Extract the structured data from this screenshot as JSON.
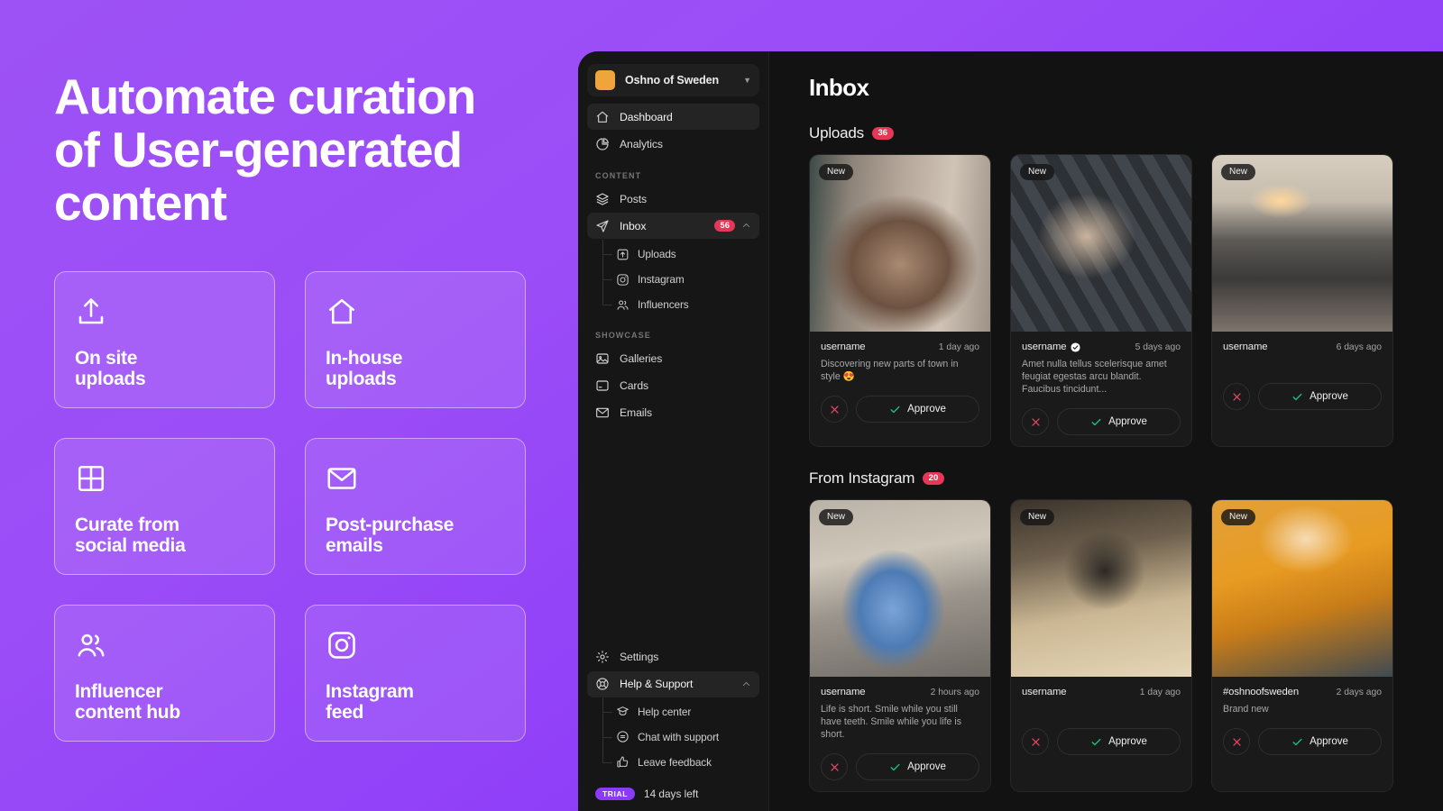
{
  "marketing": {
    "headline": "Automate curation\nof User-generated\ncontent",
    "features": [
      {
        "icon": "upload-icon",
        "label": "On site\nuploads"
      },
      {
        "icon": "home-icon",
        "label": "In-house\nuploads"
      },
      {
        "icon": "grid-icon",
        "label": "Curate from\nsocial media"
      },
      {
        "icon": "envelope-icon",
        "label": "Post-purchase\nemails"
      },
      {
        "icon": "users-icon",
        "label": "Influencer\ncontent hub"
      },
      {
        "icon": "instagram-icon",
        "label": "Instagram\nfeed"
      }
    ]
  },
  "colors": {
    "brand_purple": "#8b3bf8",
    "workspace_logo": "#f0a43c",
    "badge_red": "#e63756",
    "approve_green": "#19c37d",
    "reject_red": "#e8476a"
  },
  "sidebar": {
    "workspace": {
      "name": "Oshno of Sweden",
      "caret": "chevron-down-icon"
    },
    "top_items": [
      {
        "label": "Dashboard",
        "icon": "home-icon",
        "active": true
      },
      {
        "label": "Analytics",
        "icon": "pie-chart-icon",
        "active": false
      }
    ],
    "content_section": {
      "title": "CONTENT"
    },
    "content_items": [
      {
        "label": "Posts",
        "icon": "layers-icon",
        "active": false
      },
      {
        "label": "Inbox",
        "icon": "send-icon",
        "active": true,
        "badge": "56",
        "chevron": "chevron-up-icon"
      }
    ],
    "inbox_subitems": [
      {
        "label": "Uploads",
        "icon": "upload-box-icon"
      },
      {
        "label": "Instagram",
        "icon": "instagram-icon"
      },
      {
        "label": "Influencers",
        "icon": "users-icon"
      }
    ],
    "showcase_section": {
      "title": "SHOWCASE"
    },
    "showcase_items": [
      {
        "label": "Galleries",
        "icon": "image-icon"
      },
      {
        "label": "Cards",
        "icon": "card-icon"
      },
      {
        "label": "Emails",
        "icon": "envelope-icon"
      }
    ],
    "bottom_items": [
      {
        "label": "Settings",
        "icon": "gear-icon",
        "active": false
      },
      {
        "label": "Help & Support",
        "icon": "lifebuoy-icon",
        "active": true,
        "chevron": "chevron-up-icon"
      }
    ],
    "help_subitems": [
      {
        "label": "Help center",
        "icon": "graduation-cap-icon"
      },
      {
        "label": "Chat with support",
        "icon": "chat-icon"
      },
      {
        "label": "Leave feedback",
        "icon": "thumbs-up-icon"
      }
    ],
    "trial": {
      "badge": "TRIAL",
      "text": "14 days left"
    }
  },
  "main": {
    "title": "Inbox",
    "sections": [
      {
        "title": "Uploads",
        "count": "36",
        "cards": [
          {
            "new_badge": "New",
            "username": "username",
            "verified": false,
            "time": "1 day ago",
            "caption": "Discovering new parts of town in style 😍",
            "approve_label": "Approve",
            "photo": "ph1"
          },
          {
            "new_badge": "New",
            "username": "username",
            "verified": true,
            "time": "5 days ago",
            "caption": "Amet nulla tellus scelerisque amet feugiat egestas arcu blandit. Faucibus tincidunt...",
            "approve_label": "Approve",
            "photo": "ph2"
          },
          {
            "new_badge": "New",
            "username": "username",
            "verified": false,
            "time": "6 days ago",
            "caption": "",
            "approve_label": "Approve",
            "photo": "ph3"
          }
        ]
      },
      {
        "title": "From Instagram",
        "count": "20",
        "cards": [
          {
            "new_badge": "New",
            "username": "username",
            "verified": false,
            "time": "2 hours ago",
            "caption": "Life is short. Smile while you still have teeth. Smile while you life is short.",
            "approve_label": "Approve",
            "photo": "ph4"
          },
          {
            "new_badge": "New",
            "username": "username",
            "verified": false,
            "time": "1 day ago",
            "caption": "",
            "approve_label": "Approve",
            "photo": "ph5"
          },
          {
            "new_badge": "New",
            "username": "#oshnoofsweden",
            "verified": false,
            "time": "2 days ago",
            "caption": "Brand new",
            "approve_label": "Approve",
            "photo": "ph6"
          }
        ]
      }
    ]
  }
}
